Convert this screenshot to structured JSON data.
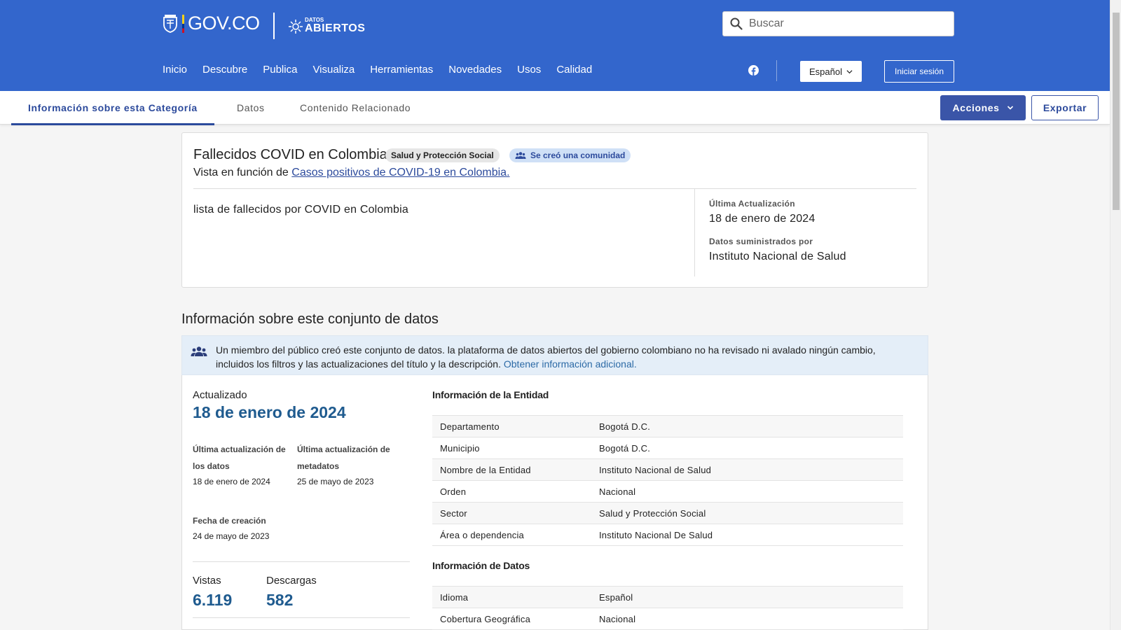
{
  "header": {
    "gov_logo_text": "GOV.CO",
    "datos_small": "DATOS",
    "datos_big": "ABIERTOS",
    "search_placeholder": "Buscar",
    "nav": [
      "Inicio",
      "Descubre",
      "Publica",
      "Visualiza",
      "Herramientas",
      "Novedades",
      "Usos",
      "Calidad"
    ],
    "language": "Español",
    "login_label": "Iniciar sesión",
    "brand_color": "#3366cc"
  },
  "tabs": {
    "items": [
      "Información sobre esta Categoría",
      "Datos",
      "Contenido Relacionado"
    ],
    "active": "Información sobre esta Categoría",
    "actions_label": "Acciones",
    "export_label": "Exportar"
  },
  "summary": {
    "title": "Fallecidos COVID en Colombia",
    "category_badge": "Salud y Protección Social",
    "community_badge": "Se creó una comunidad",
    "view_prefix": "Vista en función de",
    "view_link": "Casos positivos de COVID-19 en Colombia.",
    "description": "lista de fallecidos por COVID en Colombia",
    "last_update_label": "Última Actualización",
    "last_update_value": "18 de enero de 2024",
    "provided_by_label": "Datos suministrados por",
    "provided_by_value": "Instituto Nacional de Salud"
  },
  "about": {
    "title": "Información sobre este conjunto de datos",
    "notice_text": "Un miembro del público creó este conjunto de datos. la plataforma de datos abiertos del gobierno colombiano no ha revisado ni avalado ningún cambio, incluidos los filtros y las actualizaciones del título y la descripción.",
    "notice_link": "Obtener información adicional.",
    "updated_label": "Actualizado",
    "updated_value": "18 de enero de 2024",
    "data_update_label": "Última actualización de los datos",
    "data_update_value": "18 de enero de 2024",
    "metadata_update_label": "Última actualización de metadatos",
    "metadata_update_value": "25 de mayo de 2023",
    "created_label": "Fecha de creación",
    "created_value": "24 de mayo de 2023",
    "views_label": "Vistas",
    "views_value": "6.119",
    "downloads_label": "Descargas",
    "downloads_value": "582",
    "entity_section": "Información de la Entidad",
    "entity_rows": [
      [
        "Departamento",
        "Bogotá D.C."
      ],
      [
        "Municipio",
        "Bogotá D.C."
      ],
      [
        "Nombre de la Entidad",
        "Instituto Nacional de Salud"
      ],
      [
        "Orden",
        "Nacional"
      ],
      [
        "Sector",
        "Salud y Protección Social"
      ],
      [
        "Área o dependencia",
        "Instituto Nacional De Salud"
      ]
    ],
    "data_section": "Información de Datos",
    "data_rows": [
      [
        "Idioma",
        "Español"
      ],
      [
        "Cobertura Geográfica",
        "Nacional"
      ]
    ]
  }
}
